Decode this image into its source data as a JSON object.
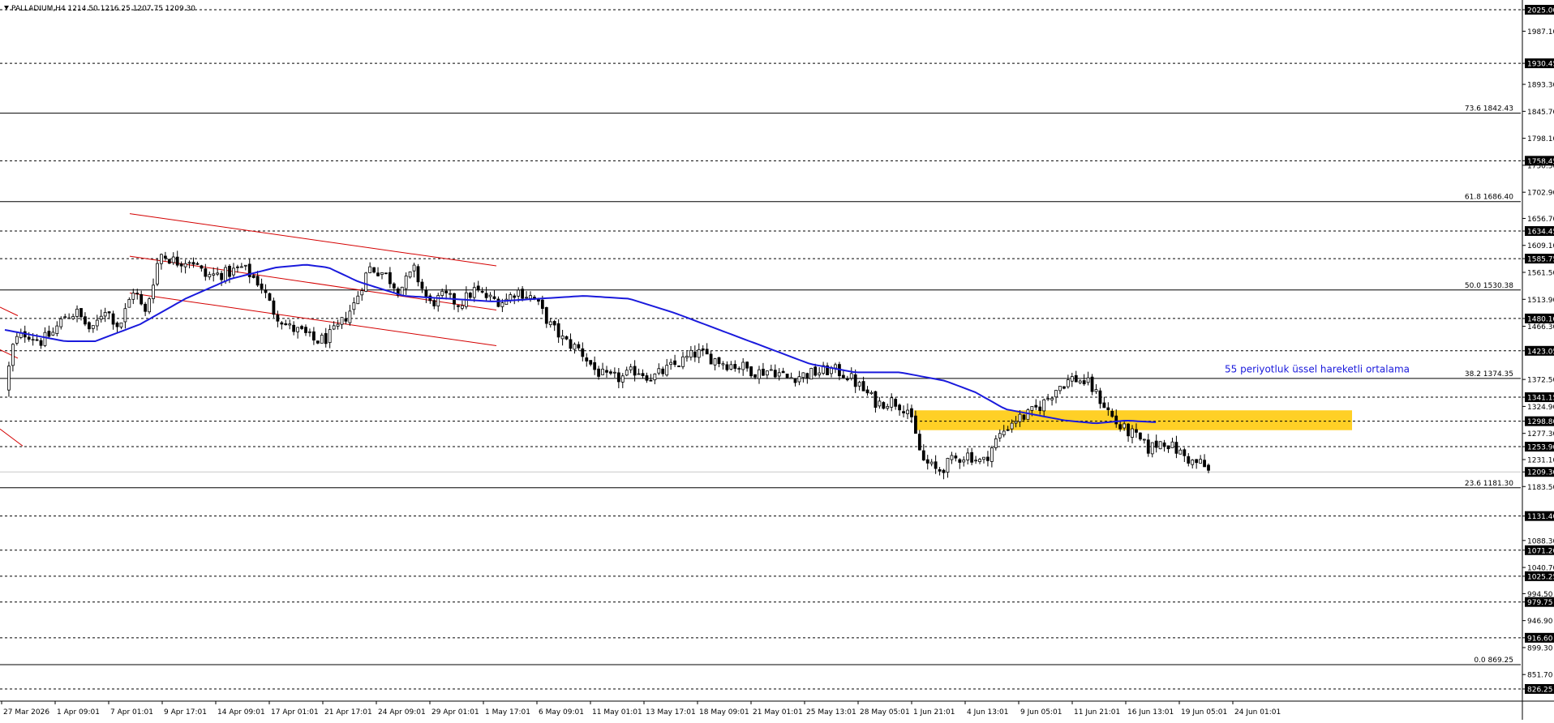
{
  "header": {
    "symbol_line": "PALLADIUM,H4  1214.50 1216.25 1207.75 1209.30"
  },
  "chart_data": {
    "type": "candlestick",
    "symbol": "PALLADIUM",
    "timeframe": "H4",
    "ohlc_last": {
      "open": 1214.5,
      "high": 1216.25,
      "low": 1207.75,
      "close": 1209.3
    },
    "ylim": [
      805.0,
      2025.0
    ],
    "price_ticks": [
      {
        "label": "2025.00",
        "value": 2025.0,
        "boxed": true
      },
      {
        "label": "1987.10",
        "value": 1987.1
      },
      {
        "label": "1930.45",
        "value": 1930.45,
        "boxed": true
      },
      {
        "label": "1893.30",
        "value": 1893.3
      },
      {
        "label": "1845.70",
        "value": 1845.7
      },
      {
        "label": "1798.10",
        "value": 1798.1
      },
      {
        "label": "1758.45",
        "value": 1758.45,
        "boxed": true
      },
      {
        "label": "1750.50",
        "value": 1750.5
      },
      {
        "label": "1702.90",
        "value": 1702.9
      },
      {
        "label": "1656.70",
        "value": 1656.7
      },
      {
        "label": "1634.45",
        "value": 1634.45,
        "boxed": true
      },
      {
        "label": "1609.10",
        "value": 1609.1
      },
      {
        "label": "1585.75",
        "value": 1585.75,
        "boxed": true
      },
      {
        "label": "1561.50",
        "value": 1561.5
      },
      {
        "label": "1513.90",
        "value": 1513.9
      },
      {
        "label": "1480.10",
        "value": 1480.1,
        "boxed": true
      },
      {
        "label": "1466.30",
        "value": 1466.3
      },
      {
        "label": "1423.05",
        "value": 1423.05,
        "boxed": true
      },
      {
        "label": "1372.50",
        "value": 1372.5
      },
      {
        "label": "1341.15",
        "value": 1341.15,
        "boxed": true
      },
      {
        "label": "1324.90",
        "value": 1324.9
      },
      {
        "label": "1298.80",
        "value": 1298.8,
        "boxed": true
      },
      {
        "label": "1277.30",
        "value": 1277.3
      },
      {
        "label": "1253.90",
        "value": 1253.9,
        "boxed": true
      },
      {
        "label": "1231.10",
        "value": 1231.1
      },
      {
        "label": "1209.30",
        "value": 1209.3,
        "boxed": true
      },
      {
        "label": "1183.50",
        "value": 1183.5
      },
      {
        "label": "1131.40",
        "value": 1131.4,
        "boxed": true
      },
      {
        "label": "1088.30",
        "value": 1088.3
      },
      {
        "label": "1071.20",
        "value": 1071.2,
        "boxed": true
      },
      {
        "label": "1040.70",
        "value": 1040.7
      },
      {
        "label": "1025.25",
        "value": 1025.25,
        "boxed": true
      },
      {
        "label": "994.50",
        "value": 994.5
      },
      {
        "label": "979.75",
        "value": 979.75,
        "boxed": true
      },
      {
        "label": "946.90",
        "value": 946.9
      },
      {
        "label": "916.60",
        "value": 916.6,
        "boxed": true
      },
      {
        "label": "899.30",
        "value": 899.3
      },
      {
        "label": "851.70",
        "value": 851.7
      },
      {
        "label": "826.25",
        "value": 826.25,
        "boxed": true
      }
    ],
    "dashed_levels": [
      2025.0,
      1930.45,
      1758.45,
      1634.45,
      1585.75,
      1480.1,
      1423.05,
      1341.15,
      1298.8,
      1253.9,
      1131.4,
      1071.2,
      1025.25,
      979.75,
      916.6,
      826.25
    ],
    "fib_levels": [
      {
        "label": "73.6 1842.43",
        "value": 1842.43
      },
      {
        "label": "61.8 1686.40",
        "value": 1686.4
      },
      {
        "label": "50.0 1530.38",
        "value": 1530.38
      },
      {
        "label": "38.2 1374.35",
        "value": 1374.35
      },
      {
        "label": "23.6 1181.30",
        "value": 1181.3
      },
      {
        "label": "0.0 869.25",
        "value": 869.25
      }
    ],
    "time_labels": [
      "27 Mar 2026",
      "1 Apr 09:01",
      "7 Apr 01:01",
      "9 Apr 17:01",
      "14 Apr 09:01",
      "17 Apr 01:01",
      "21 Apr 17:01",
      "24 Apr 09:01",
      "29 Apr 01:01",
      "1 May 17:01",
      "6 May 09:01",
      "11 May 01:01",
      "13 May 17:01",
      "18 May 09:01",
      "21 May 01:01",
      "25 May 13:01",
      "28 May 05:01",
      "1 Jun 21:01",
      "4 Jun 13:01",
      "9 Jun 05:01",
      "11 Jun 21:01",
      "16 Jun 13:01",
      "19 Jun 05:01",
      "24 Jun 01:01"
    ],
    "bar_count": 300,
    "close_anchors": [
      [
        0,
        1355
      ],
      [
        6,
        1440
      ],
      [
        14,
        1455
      ],
      [
        24,
        1440
      ],
      [
        32,
        1455
      ],
      [
        40,
        1485
      ],
      [
        48,
        1490
      ],
      [
        58,
        1455
      ],
      [
        66,
        1500
      ],
      [
        76,
        1465
      ],
      [
        86,
        1535
      ],
      [
        93,
        1485
      ],
      [
        103,
        1595
      ],
      [
        114,
        1580
      ],
      [
        124,
        1585
      ],
      [
        133,
        1555
      ],
      [
        148,
        1560
      ],
      [
        158,
        1570
      ],
      [
        170,
        1540
      ],
      [
        178,
        1495
      ],
      [
        188,
        1465
      ],
      [
        198,
        1455
      ],
      [
        206,
        1440
      ],
      [
        214,
        1445
      ],
      [
        222,
        1465
      ],
      [
        232,
        1505
      ],
      [
        242,
        1570
      ],
      [
        252,
        1560
      ],
      [
        262,
        1530
      ],
      [
        272,
        1565
      ],
      [
        282,
        1505
      ],
      [
        292,
        1520
      ],
      [
        302,
        1505
      ],
      [
        312,
        1530
      ],
      [
        322,
        1515
      ],
      [
        332,
        1510
      ],
      [
        340,
        1530
      ],
      [
        352,
        1515
      ],
      [
        362,
        1470
      ],
      [
        372,
        1440
      ],
      [
        382,
        1425
      ],
      [
        392,
        1390
      ],
      [
        400,
        1375
      ],
      [
        410,
        1375
      ],
      [
        420,
        1390
      ],
      [
        430,
        1375
      ],
      [
        440,
        1390
      ],
      [
        450,
        1405
      ],
      [
        460,
        1420
      ],
      [
        470,
        1410
      ],
      [
        480,
        1400
      ],
      [
        490,
        1395
      ],
      [
        500,
        1385
      ],
      [
        510,
        1390
      ],
      [
        520,
        1375
      ],
      [
        530,
        1380
      ],
      [
        540,
        1385
      ],
      [
        550,
        1390
      ],
      [
        560,
        1380
      ],
      [
        570,
        1355
      ],
      [
        580,
        1330
      ],
      [
        590,
        1335
      ],
      [
        600,
        1320
      ],
      [
        610,
        1230
      ],
      [
        620,
        1210
      ],
      [
        630,
        1230
      ],
      [
        640,
        1240
      ],
      [
        650,
        1225
      ],
      [
        660,
        1270
      ],
      [
        670,
        1300
      ],
      [
        680,
        1310
      ],
      [
        690,
        1330
      ],
      [
        700,
        1360
      ],
      [
        710,
        1375
      ],
      [
        720,
        1365
      ],
      [
        730,
        1330
      ],
      [
        740,
        1290
      ],
      [
        750,
        1275
      ],
      [
        760,
        1250
      ],
      [
        770,
        1265
      ],
      [
        780,
        1245
      ],
      [
        790,
        1225
      ],
      [
        796,
        1225
      ],
      [
        799,
        1209.3
      ]
    ],
    "ema": {
      "label": "55 periyotluk üssel hareketli ortalama",
      "period": 55,
      "color": "#1a1adc",
      "anchors": [
        [
          0,
          1460
        ],
        [
          40,
          1440
        ],
        [
          60,
          1440
        ],
        [
          90,
          1470
        ],
        [
          120,
          1515
        ],
        [
          150,
          1550
        ],
        [
          180,
          1570
        ],
        [
          200,
          1575
        ],
        [
          215,
          1570
        ],
        [
          235,
          1545
        ],
        [
          265,
          1520
        ],
        [
          295,
          1515
        ],
        [
          325,
          1510
        ],
        [
          355,
          1515
        ],
        [
          385,
          1520
        ],
        [
          415,
          1515
        ],
        [
          445,
          1490
        ],
        [
          475,
          1460
        ],
        [
          505,
          1430
        ],
        [
          535,
          1400
        ],
        [
          565,
          1385
        ],
        [
          595,
          1385
        ],
        [
          625,
          1370
        ],
        [
          645,
          1350
        ],
        [
          665,
          1320
        ],
        [
          685,
          1310
        ],
        [
          705,
          1300
        ],
        [
          725,
          1295
        ],
        [
          745,
          1300
        ],
        [
          765,
          1297
        ]
      ]
    },
    "zone": {
      "low": 1283,
      "high": 1318,
      "color": "#ffc800",
      "from_index": 610,
      "to_index": 900
    },
    "channel": {
      "color": "#d40000",
      "lines": [
        {
          "from": [
            86,
            1665
          ],
          "to": [
            325,
            1573
          ]
        },
        {
          "from": [
            86,
            1590
          ],
          "to": [
            325,
            1495
          ]
        },
        {
          "from": [
            86,
            1525
          ],
          "to": [
            325,
            1432
          ]
        }
      ]
    },
    "colors": {
      "up": "#ffffff",
      "down": "#000000",
      "wick": "#000000",
      "grid": "#000000"
    }
  }
}
